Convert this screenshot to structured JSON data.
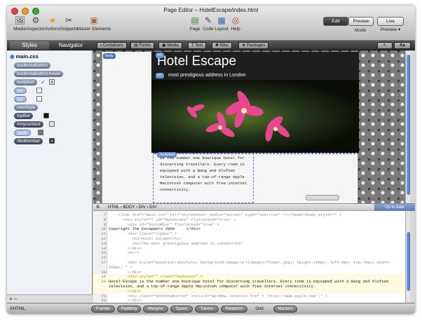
{
  "window": {
    "title": "Page Editor – HotelEscape/index.html"
  },
  "toolbar": {
    "left_tools": [
      "Media",
      "Inspector",
      "Actions",
      "Snippets",
      "Master Elements"
    ],
    "center_tools": [
      "Page",
      "Code",
      "Layout",
      "Help"
    ],
    "mode_segments": [
      "Edit",
      "Preview"
    ],
    "mode_label": "Mode",
    "live_preview": "Live Preview"
  },
  "panel_tabs": {
    "styles": "Styles",
    "navigator": "Navigator"
  },
  "panel_buttons": [
    "Containers",
    "Forms",
    "Media",
    "Text",
    "Misc",
    "Packages"
  ],
  "aa": "Aa",
  "sidebar": {
    "file": "main.css",
    "items": [
      "booknowbutton",
      "booknowbutton:hover",
      "bodytext",
      "h1",
      "h2",
      "newStyle",
      "topBar",
      "#mycontent",
      "body",
      "#bottombar"
    ]
  },
  "canvas": {
    "page_tag": "body",
    "title": "Hotel Escape",
    "subtitle": "most prestigious address in London",
    "body_text": "is the number one boutique hotel for discerning travellers. Every room is equipped with a Bang and Olufsen television, and a top-of-range Apple Macintosh computer with free internet connectivity.",
    "class_tag": ".bodytext"
  },
  "breadcrumb": [
    "HTML",
    "BODY",
    "DIV",
    "DIV"
  ],
  "status": "Up to date",
  "code_lines": [
    {
      "n": "7",
      "text": "    <link href=\"main.css\" rel=\"stylesheet\" media=\"screen\" type=\"text/css\" /></head><body style=\"\" >"
    },
    {
      "n": "8",
      "text": "      <div style=\"\" id=\"mycontent\" fluxlocked=\"true\" >"
    },
    {
      "n": "9",
      "text": "        <div id=\"bottombar\" fluxlocked=\"true\" >"
    },
    {
      "n": "10",
      "text": "Copyright The Escappers 2009     </div>"
    },
    {
      "n": "11",
      "text": "        <div class=\"topBar\" >"
    },
    {
      "n": "12",
      "text": "          <h1>Hotel Escape</h1>"
    },
    {
      "n": "13",
      "text": "          <h2>The most prestigious address in London</h2>"
    },
    {
      "n": "14",
      "text": "        </div>"
    },
    {
      "n": "15",
      "text": "        <hr/>"
    },
    {
      "n": "16",
      "text": ""
    },
    {
      "n": "17",
      "text": "        <div style=\"position:absolute; background-image:url(images/flower.jpg); height:196px; left:0px; top:79px; width:"
    },
    {
      "n": "",
      "text": "600px; \" >"
    },
    {
      "n": "18",
      "text": "        </div>"
    },
    {
      "n": "19",
      "text": "        <div style=\"\" class=\"bodytext\" >"
    },
    {
      "n": "20",
      "text": "Hotel Escape is the number one boutique hotel for discerning travellers. Every room is equipped with a Bang and Olufsen"
    },
    {
      "n": "",
      "text": "television, and a top-of-range Apple Macintosh computer with free internet connectivity."
    },
    {
      "n": "",
      "text": "        </div>"
    },
    {
      "n": "21",
      "text": "        <div class=\"booknowbutton\" onclick=\"window.location.href = 'http://www.apple.com';\" >"
    },
    {
      "n": "22",
      "text": "        </div>"
    }
  ],
  "bottom": {
    "doctype": "XHTML",
    "tabs": [
      "Frames",
      "Padding",
      "Margins",
      "Spans",
      "Tokens",
      "Relations"
    ],
    "grid": "Grid",
    "masters": "Masters"
  },
  "colors": {
    "accent": "#3d6fc6",
    "selection": "#6b8fd6",
    "close": "#e0443e",
    "minimize": "#e2a22a",
    "zoom": "#3fa73a"
  }
}
